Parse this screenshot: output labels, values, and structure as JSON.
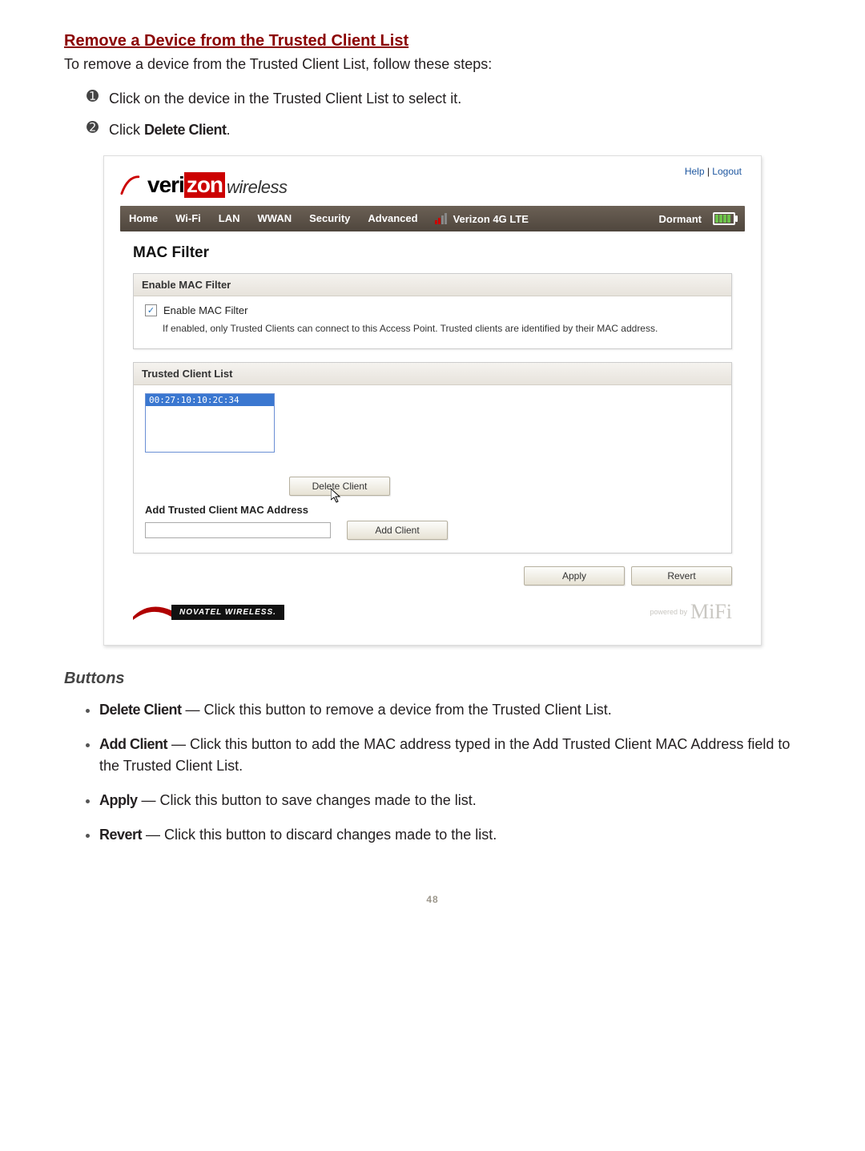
{
  "doc": {
    "heading": "Remove a Device from the Trusted Client List",
    "intro": "To remove a device from the Trusted Client List, follow these steps:",
    "step1_num": "➊",
    "step1": "Click on the device in the Trusted Client List to select it.",
    "step2_num": "➋",
    "step2_a": "Click ",
    "step2_b": "Delete Client",
    "step2_c": ".",
    "buttons_heading": "Buttons",
    "b1_name": "Delete Client",
    "b1_desc": " — Click this button to remove a device from the Trusted Client List.",
    "b2_name": "Add Client",
    "b2_desc": " — Click this button to add the MAC address typed in the Add Trusted Client MAC Address field to the Trusted Client List.",
    "b3_name": "Apply",
    "b3_desc": " — Click this button to save changes made to the list.",
    "b4_name": "Revert",
    "b4_desc": " — Click this button to discard changes made to the list.",
    "pagenum": "48"
  },
  "app": {
    "top_links": {
      "help": "Help",
      "sep": " | ",
      "logout": "Logout"
    },
    "logo": {
      "veri": "veri",
      "zon": "zon",
      "wireless": "wireless"
    },
    "nav": {
      "home": "Home",
      "wifi": "Wi-Fi",
      "lan": "LAN",
      "wwan": "WWAN",
      "security": "Security",
      "advanced": "Advanced",
      "carrier": "Verizon  4G LTE",
      "state": "Dormant"
    },
    "page_title": "MAC Filter",
    "panel1": {
      "head": "Enable MAC Filter",
      "chk_label": "Enable MAC Filter",
      "chk_mark": "✓",
      "desc": "If enabled, only Trusted Clients can connect to this Access Point. Trusted clients are identified by their MAC address."
    },
    "panel2": {
      "head": "Trusted Client List",
      "selected_mac": "00:27:10:10:2C:34",
      "delete_btn": "Delete Client",
      "add_section": "Add Trusted Client MAC Address",
      "add_btn": "Add Client"
    },
    "actions": {
      "apply": "Apply",
      "revert": "Revert"
    },
    "footer": {
      "novatel": "NOVATEL WIRELESS.",
      "powered": "powered by",
      "mifi": "MiFi"
    }
  }
}
